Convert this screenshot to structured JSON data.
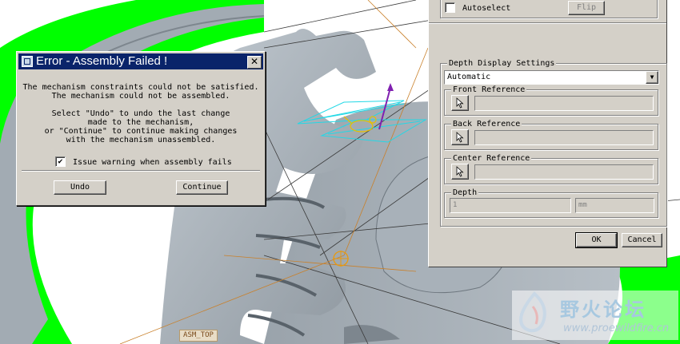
{
  "error_dialog": {
    "title": "Error - Assembly Failed !",
    "close_glyph": "✕",
    "message_line1": "The mechanism constraints could not be satisfied.",
    "message_line2": "The mechanism could not be assembled.",
    "message_line3": "Select \"Undo\" to undo the last change",
    "message_line4": "made to the mechanism,",
    "message_line5": "or \"Continue\" to continue making changes",
    "message_line6": "with the mechanism unassembled.",
    "checkbox_label": "Issue warning when assembly fails",
    "checkbox_checked": true,
    "check_glyph": "✔",
    "undo_label": "Undo",
    "continue_label": "Continue"
  },
  "panel": {
    "autoselect_label": "Autoselect",
    "flip_label": "Flip",
    "depth_display_settings_label": "Depth Display Settings",
    "depth_mode_value": "Automatic",
    "dropdown_glyph": "▼",
    "front_reference_label": "Front Reference",
    "back_reference_label": "Back Reference",
    "center_reference_label": "Center Reference",
    "depth_label": "Depth",
    "depth_value": "1",
    "depth_unit": "mm",
    "ok_label": "OK",
    "cancel_label": "Cancel"
  },
  "viewport": {
    "datum_label": "ASM_TOP"
  },
  "watermark": {
    "title": "野火论坛",
    "url": "www.proewildfire.cn"
  },
  "colors": {
    "background_green": "#00ff00",
    "title_bar": "#0a246a",
    "dialog_face": "#d4d0c8",
    "gear_grey": "#a9b2ba",
    "datum_cyan": "#22d8e6"
  }
}
